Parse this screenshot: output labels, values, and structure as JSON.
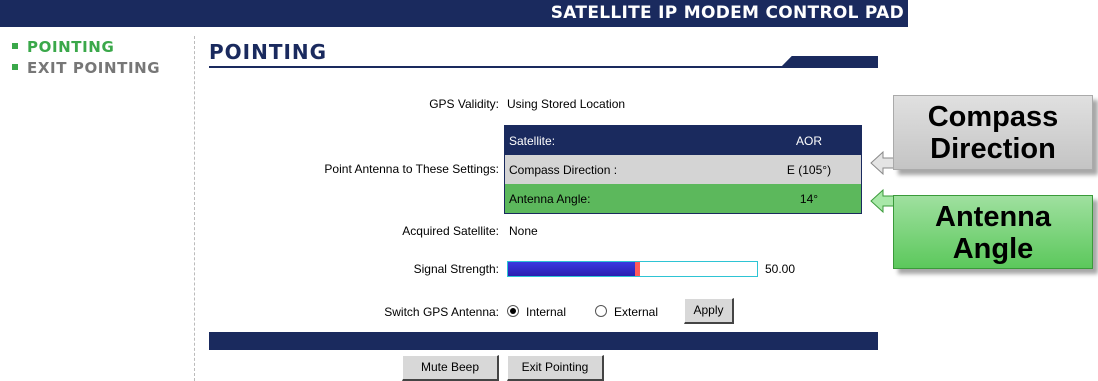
{
  "header": {
    "title": "SATELLITE IP MODEM CONTROL PAD"
  },
  "sidebar": {
    "items": [
      {
        "label": "POINTING"
      },
      {
        "label": "EXIT POINTING"
      }
    ]
  },
  "page": {
    "title": "POINTING"
  },
  "form": {
    "gps_validity": {
      "label": "GPS Validity:",
      "value": "Using Stored Location"
    },
    "point_antenna_label": "Point Antenna to These Settings:",
    "settings": [
      {
        "name": "Satellite:",
        "value": "AOR"
      },
      {
        "name": "Compass Direction :",
        "value": "E (105°)"
      },
      {
        "name": "Antenna Angle:",
        "value": "14°"
      }
    ],
    "acquired_satellite": {
      "label": "Acquired Satellite:",
      "value": "None"
    },
    "signal_strength": {
      "label": "Signal Strength:",
      "value": "50.00",
      "fill_fraction": 0.53
    },
    "switch_gps": {
      "label": "Switch GPS Antenna:",
      "options": [
        "Internal",
        "External"
      ],
      "selected": "Internal",
      "apply_label": "Apply"
    }
  },
  "buttons": {
    "mute_beep": "Mute Beep",
    "exit_pointing": "Exit Pointing"
  },
  "callouts": {
    "compass": {
      "line1": "Compass",
      "line2": "Direction"
    },
    "antenna": {
      "line1": "Antenna",
      "line2": "Angle"
    }
  },
  "colors": {
    "navy": "#1a2a5e",
    "nav_green": "#3aa84a",
    "antenna_green": "#5cb85c",
    "compass_gray": "#d4d4d4",
    "signal_blue": "#2a1fb0",
    "signal_red": "#ff5a5a"
  }
}
